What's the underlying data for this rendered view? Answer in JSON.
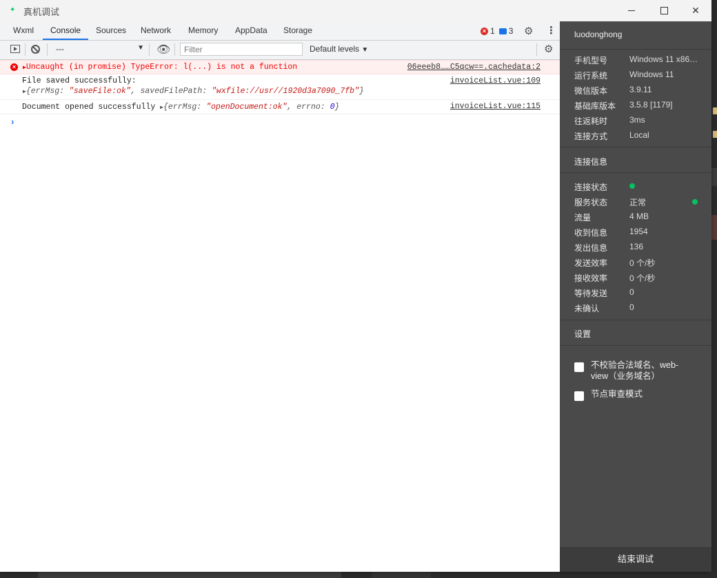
{
  "window": {
    "title": "真机调试"
  },
  "tabs": [
    {
      "label": "Wxml",
      "active": false
    },
    {
      "label": "Console",
      "active": true
    },
    {
      "label": "Sources",
      "active": false
    },
    {
      "label": "Network",
      "active": false
    },
    {
      "label": "Memory",
      "active": false
    },
    {
      "label": "AppData",
      "active": false
    },
    {
      "label": "Storage",
      "active": false
    }
  ],
  "badges": {
    "errors": "1",
    "messages": "3"
  },
  "toolbar": {
    "context": "---",
    "filter_placeholder": "Filter",
    "levels": "Default levels"
  },
  "console": {
    "error": {
      "text": "Uncaught (in promise) TypeError: l(...) is not a function",
      "source": "06eeeb8……C5qcw==.cachedata:2"
    },
    "log1": {
      "text": "File saved successfully:",
      "obj_open": "{",
      "k1": "errMsg",
      "v1": "\"saveFile:ok\"",
      "k2": "savedFilePath",
      "v2": "\"wxfile://usr//1920d3a7090_7fb\"",
      "obj_close": "}",
      "source": "invoiceList.vue:109"
    },
    "log2": {
      "text": "Document opened successfully",
      "k1": "errMsg",
      "v1": "\"openDocument:ok\"",
      "k2": "errno",
      "v2": "0",
      "source": "invoiceList.vue:115"
    },
    "prompt": "›"
  },
  "panel": {
    "user": "luodonghong",
    "device": [
      {
        "k": "手机型号",
        "v": "Windows 11 x86…"
      },
      {
        "k": "运行系统",
        "v": "Windows 11"
      },
      {
        "k": "微信版本",
        "v": "3.9.11"
      },
      {
        "k": "基础库版本",
        "v": "3.5.8 [1179]"
      },
      {
        "k": "往返耗时",
        "v": "3ms"
      },
      {
        "k": "连接方式",
        "v": "Local"
      }
    ],
    "conn_title": "连接信息",
    "conn": [
      {
        "k": "连接状态",
        "v": ""
      },
      {
        "k": "服务状态",
        "v": "正常"
      },
      {
        "k": "流量",
        "v": "4 MB"
      },
      {
        "k": "收到信息",
        "v": "1954"
      },
      {
        "k": "发出信息",
        "v": "136"
      },
      {
        "k": "发送效率",
        "v": "0 个/秒"
      },
      {
        "k": "接收效率",
        "v": "0 个/秒"
      },
      {
        "k": "等待发送",
        "v": "0"
      },
      {
        "k": "未确认",
        "v": "0"
      }
    ],
    "settings_title": "设置",
    "options": [
      {
        "label": "不校验合法域名、web-view（业务域名）",
        "checked": false
      },
      {
        "label": "节点审查模式",
        "checked": false
      }
    ],
    "end_button": "结束调试"
  }
}
